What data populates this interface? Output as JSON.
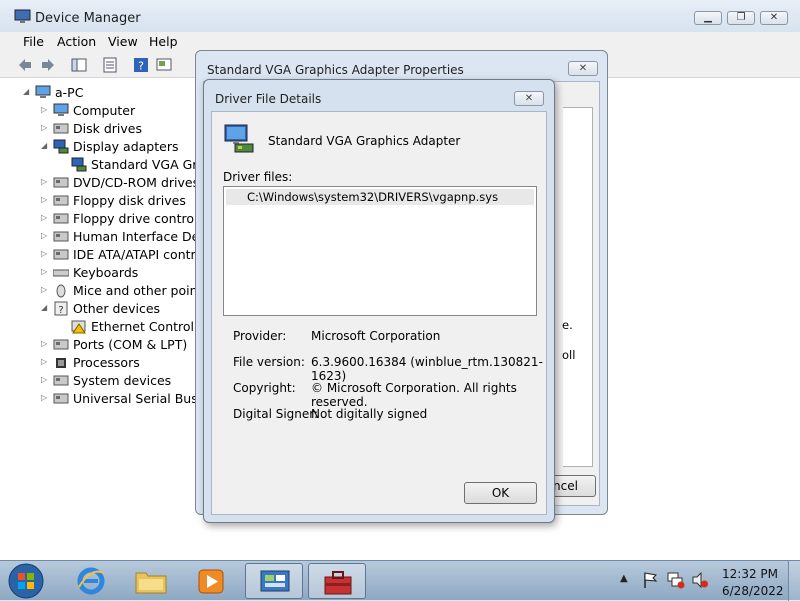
{
  "device_manager": {
    "title": "Device Manager",
    "menu": [
      "File",
      "Action",
      "View",
      "Help"
    ],
    "tree": [
      {
        "label": "a-PC",
        "icon": "computer-icon",
        "level": 0
      },
      {
        "label": "Computer",
        "icon": "computer-icon",
        "level": 1
      },
      {
        "label": "Disk drives",
        "icon": "disk-drive-icon",
        "level": 1
      },
      {
        "label": "Display adapters",
        "icon": "display-adapter-icon",
        "level": 1
      },
      {
        "label": "Standard VGA Grap",
        "icon": "display-adapter-icon",
        "level": 2
      },
      {
        "label": "DVD/CD-ROM drives",
        "icon": "dvd-drive-icon",
        "level": 1
      },
      {
        "label": "Floppy disk drives",
        "icon": "floppy-icon",
        "level": 1
      },
      {
        "label": "Floppy drive controller",
        "icon": "controller-icon",
        "level": 1
      },
      {
        "label": "Human Interface Devic",
        "icon": "hid-icon",
        "level": 1
      },
      {
        "label": "IDE ATA/ATAPI contro",
        "icon": "ide-icon",
        "level": 1
      },
      {
        "label": "Keyboards",
        "icon": "keyboard-icon",
        "level": 1
      },
      {
        "label": "Mice and other pointin",
        "icon": "mouse-icon",
        "level": 1
      },
      {
        "label": "Other devices",
        "icon": "unknown-device-icon",
        "level": 1
      },
      {
        "label": "Ethernet Controller",
        "icon": "warning-device-icon",
        "level": 2
      },
      {
        "label": "Ports (COM & LPT)",
        "icon": "port-icon",
        "level": 1
      },
      {
        "label": "Processors",
        "icon": "processor-icon",
        "level": 1
      },
      {
        "label": "System devices",
        "icon": "system-device-icon",
        "level": 1
      },
      {
        "label": "Universal Serial Bus co",
        "icon": "usb-icon",
        "level": 1
      }
    ]
  },
  "properties_dialog": {
    "title": "Standard VGA Graphics Adapter Properties",
    "cancel_fragment": "ncel",
    "text_fragment_1": "e.",
    "text_fragment_2": "oll"
  },
  "driver_details": {
    "title": "Driver File Details",
    "device_name": "Standard VGA Graphics Adapter",
    "driver_files_label": "Driver files:",
    "files": [
      "C:\\Windows\\system32\\DRIVERS\\vgapnp.sys"
    ],
    "provider_label": "Provider:",
    "provider_value": "Microsoft Corporation",
    "file_version_label": "File version:",
    "file_version_value": "6.3.9600.16384 (winblue_rtm.130821-1623)",
    "copyright_label": "Copyright:",
    "copyright_value": "© Microsoft Corporation. All rights reserved.",
    "signer_label": "Digital Signer:",
    "signer_value": "Not digitally signed",
    "ok_label": "OK"
  },
  "taskbar": {
    "time": "12:32 PM",
    "date": "6/28/2022"
  }
}
